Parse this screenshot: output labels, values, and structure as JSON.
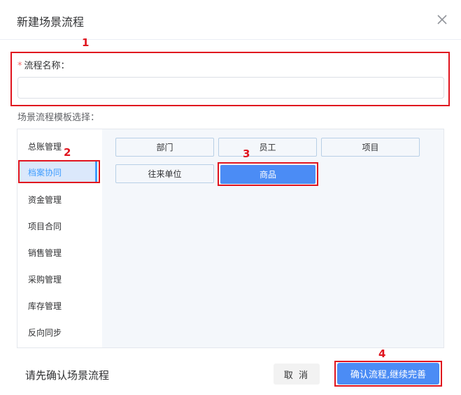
{
  "dialog": {
    "title": "新建场景流程",
    "close_icon": "close-icon"
  },
  "form": {
    "required_mark": "*",
    "name_label": "流程名称：",
    "name_value": "",
    "template_label": "场景流程模板选择："
  },
  "categories": [
    {
      "label": "总账管理",
      "active": false
    },
    {
      "label": "档案协同",
      "active": true
    },
    {
      "label": "资金管理",
      "active": false
    },
    {
      "label": "项目合同",
      "active": false
    },
    {
      "label": "销售管理",
      "active": false
    },
    {
      "label": "采购管理",
      "active": false
    },
    {
      "label": "库存管理",
      "active": false
    },
    {
      "label": "反向同步",
      "active": false
    }
  ],
  "options": [
    {
      "label": "部门",
      "selected": false
    },
    {
      "label": "员工",
      "selected": false
    },
    {
      "label": "项目",
      "selected": false
    },
    {
      "label": "往来单位",
      "selected": false
    },
    {
      "label": "商品",
      "selected": true
    }
  ],
  "footer": {
    "hint": "请先确认场景流程",
    "cancel_label": "取 消",
    "confirm_label": "确认流程,继续完善"
  },
  "annotations": [
    "1",
    "2",
    "3",
    "4"
  ],
  "colors": {
    "accent": "#409eff",
    "selected_fill": "#4b8cf5",
    "annotation_red": "#e0141e"
  }
}
